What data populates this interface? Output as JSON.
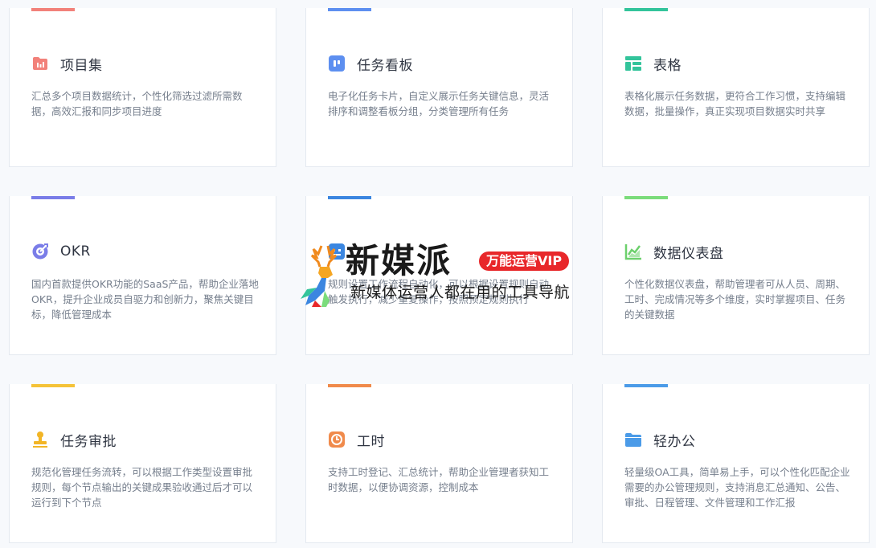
{
  "cards": [
    {
      "title": "项目集",
      "desc": "汇总多个项目数据统计，个性化筛选过滤所需数据，高效汇报和同步项目进度",
      "accent": "#f2817a",
      "icon": "project-set-icon",
      "icon_color": "#f2817a"
    },
    {
      "title": "任务看板",
      "desc": "电子化任务卡片，自定义展示任务关键信息，灵活排序和调整看板分组，分类管理所有任务",
      "accent": "#5d8ff0",
      "icon": "kanban-icon",
      "icon_color": "#5d8ff0"
    },
    {
      "title": "表格",
      "desc": "表格化展示任务数据，更符合工作习惯，支持编辑数据，批量操作，真正实现项目数据实时共享",
      "accent": "#33c49b",
      "icon": "table-icon",
      "icon_color": "#33c49b"
    },
    {
      "title": "OKR",
      "desc": "国内首款提供OKR功能的SaaS产品，帮助企业落地OKR，提升企业成员自驱力和创新力，聚焦关键目标，降低管理成本",
      "accent": "#7a7de8",
      "icon": "target-icon",
      "icon_color": "#7a7de8"
    },
    {
      "title": "",
      "desc": "规则设置工作流程自动化，可以根据设置规则自动触发执行，减少重复操作，按照预定规则执行",
      "accent": "#3b86e0",
      "icon": "automation-icon",
      "icon_color": "#3b86e0"
    },
    {
      "title": "数据仪表盘",
      "desc": "个性化数据仪表盘，帮助管理者可从人员、周期、工时、完成情况等多个维度，实时掌握项目、任务的关键数据",
      "accent": "#7bdc7b",
      "icon": "chart-icon",
      "icon_color": "#6cd06c"
    },
    {
      "title": "任务审批",
      "desc": "规范化管理任务流转，可以根据工作类型设置审批规则，每个节点输出的关键成果验收通过后才可以运行到下个节点",
      "accent": "#f5c338",
      "icon": "stamp-icon",
      "icon_color": "#f2b526"
    },
    {
      "title": "工时",
      "desc": "支持工时登记、汇总统计，帮助企业管理者获知工时数据，以便协调资源，控制成本",
      "accent": "#f08a4b",
      "icon": "clock-icon",
      "icon_color": "#f08a4b"
    },
    {
      "title": "轻办公",
      "desc": "轻量级OA工具，简单易上手，可以个性化匹配企业需要的办公管理规则，支持消息汇总通知、公告、审批、日程管理、文件管理和工作汇报",
      "accent": "#4b9be8",
      "icon": "folder-icon",
      "icon_color": "#4b9be8"
    }
  ],
  "watermark": {
    "brand": "新媒派",
    "badge": "万能运营VIP",
    "tagline": "新媒体运营人都在用的工具导航"
  }
}
